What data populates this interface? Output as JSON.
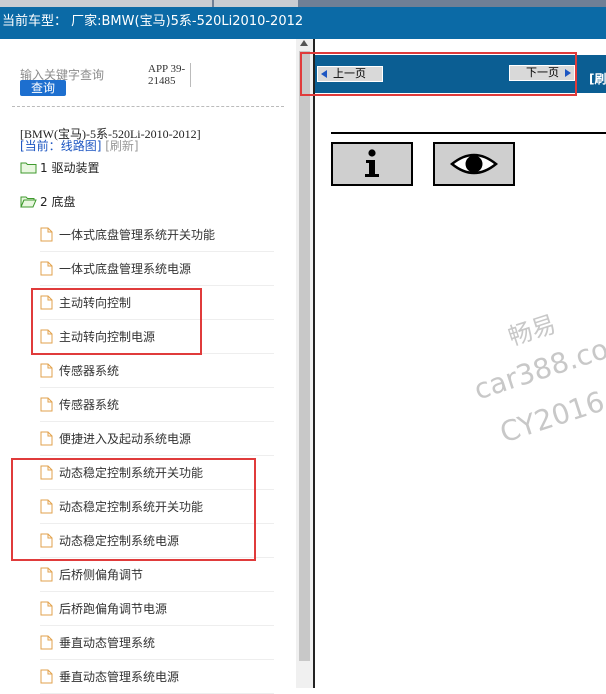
{
  "window": {
    "vehicle_text": "当前车型：  厂家:BMW(宝马)5系-520Li2010-2012"
  },
  "search": {
    "placeholder": "输入关键字查询",
    "button_label": "查询",
    "app_code": "APP 39-21485"
  },
  "tree": {
    "title": "[BMW(宝马)-5系-520Li-2010-2012]",
    "current_label": "[当前：",
    "current_link": "线路图",
    "refresh_label": "[刷新]",
    "folders": [
      {
        "label": "1 驱动装置"
      },
      {
        "label": "2 底盘"
      }
    ],
    "items": [
      {
        "label": "一体式底盘管理系统开关功能"
      },
      {
        "label": "一体式底盘管理系统电源"
      },
      {
        "label": "主动转向控制"
      },
      {
        "label": "主动转向控制电源"
      },
      {
        "label": "传感器系统"
      },
      {
        "label": "传感器系统"
      },
      {
        "label": "便捷进入及起动系统电源"
      },
      {
        "label": "动态稳定控制系统开关功能"
      },
      {
        "label": "动态稳定控制系统开关功能"
      },
      {
        "label": "动态稳定控制系统电源"
      },
      {
        "label": "后桥侧偏角调节"
      },
      {
        "label": "后桥跑偏角调节电源"
      },
      {
        "label": "垂直动态管理系统"
      },
      {
        "label": "垂直动态管理系统电源"
      }
    ]
  },
  "viewer": {
    "prev_label": "上一页",
    "next_label": "下一页",
    "extra_label": "[刷"
  },
  "watermark": {
    "line1": "畅易",
    "line2": "car388.com",
    "line3": "CY2016"
  },
  "colors": {
    "vehicle_bar": "#0b6aa6",
    "nav_bar": "#0b5e93",
    "highlight_box": "#e03b3b"
  }
}
